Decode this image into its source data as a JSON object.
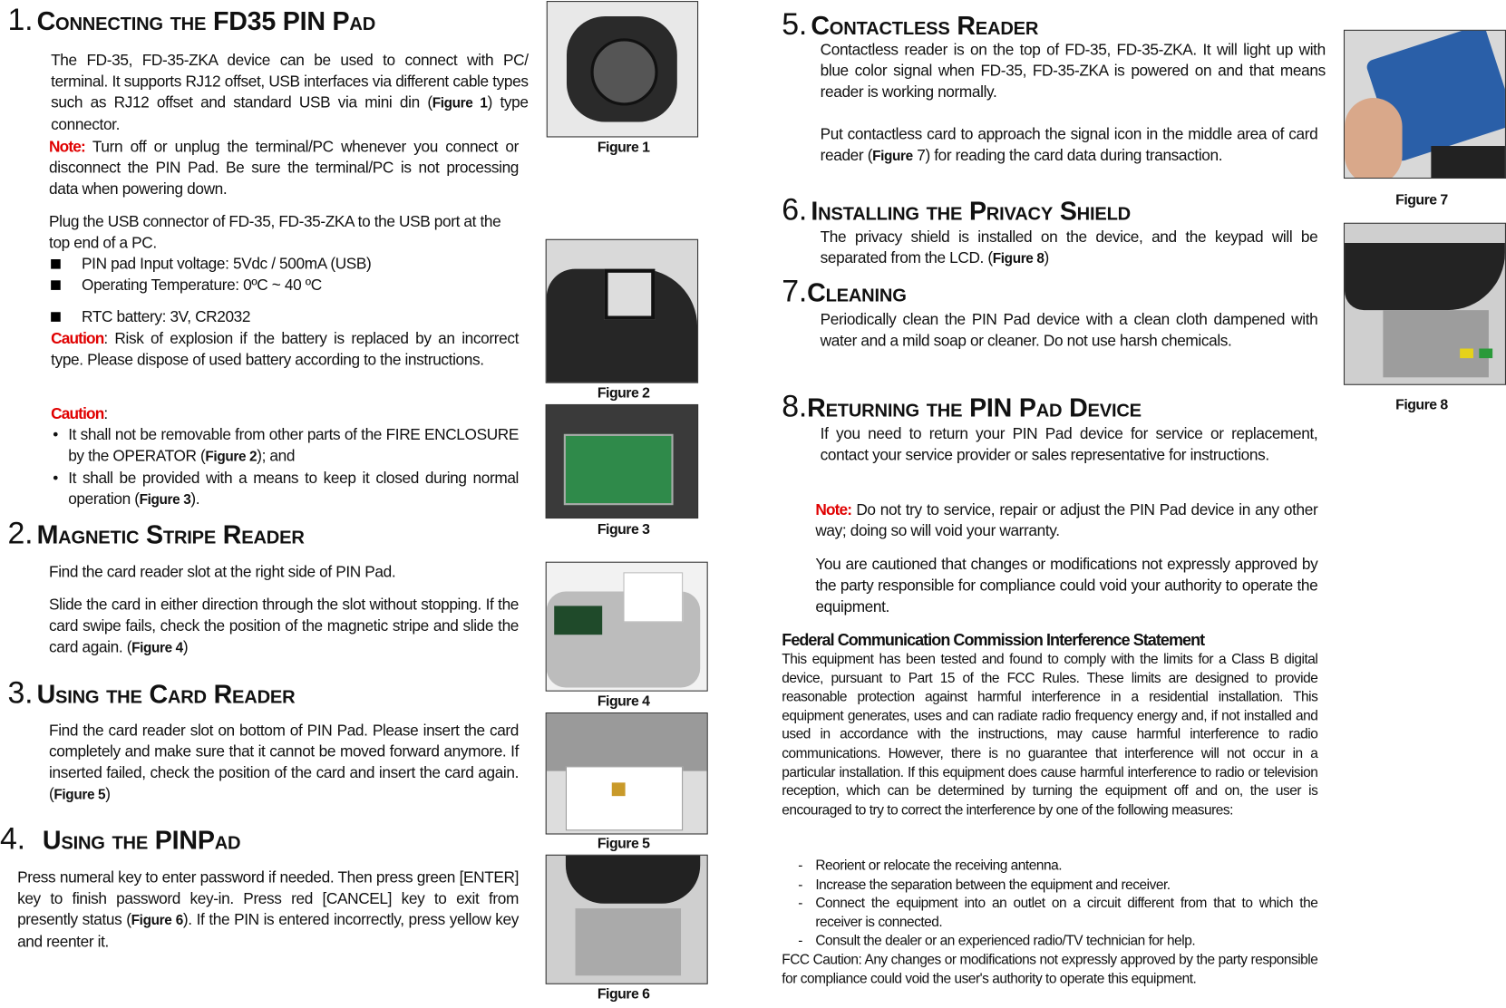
{
  "s1": {
    "num": "1.",
    "title": "Connecting the FD35 PIN Pad",
    "p1": "The FD-35, FD-35-ZKA device can be used to connect with PC/ terminal. It supports RJ12 offset, USB interfaces via different cable types such as RJ12 offset and standard USB via mini din (",
    "p1_ref": "Figure 1",
    "p1_end": ") type connector.",
    "note_label": "Note:",
    "note": " Turn off or unplug the terminal/PC whenever you connect or disconnect the PIN Pad.  Be sure the terminal/PC is not processing data when powering down.",
    "plug": "Plug the USB connector of FD-35, FD-35-ZKA to the USB port at the top end of a PC.",
    "bullets": [
      "PIN pad Input voltage: 5Vdc /  500mA (USB)",
      "Operating Temperature: 0ºC ~ 40 ºC",
      "RTC battery: 3V, CR2032"
    ],
    "caution_label": "Caution",
    "caution": ": Risk of explosion if the battery is replaced by an incorrect type. Please dispose of used battery according to the instructions.",
    "caution2_label": "Caution",
    "caution2_colon": ":",
    "c_items": [
      {
        "text": "It shall not be removable from other parts of the FIRE ENCLOSURE by the OPERATOR (",
        "ref": "Figure 2",
        "end": "); and"
      },
      {
        "text": "It shall be provided with a means to keep it closed during normal operation (",
        "ref": "Figure 3",
        "end": ")."
      }
    ]
  },
  "s2": {
    "num": "2.",
    "title": "Magnetic Stripe Reader",
    "p1": "Find the card reader slot at the right side of PIN Pad.",
    "p2": "Slide the card in either direction through the slot without stopping. If the card swipe fails, check the position of the magnetic stripe and slide the card again. (",
    "p2_ref": "Figure 4",
    "p2_end": ")"
  },
  "s3": {
    "num": "3.",
    "title": "Using the Card Reader",
    "p1": "Find the card reader slot on bottom of PIN Pad. Please insert the card completely and make sure that it cannot be moved forward anymore. If inserted failed, check the position of the card and insert the card again. (",
    "p1_ref": "Figure 5",
    "p1_end": ")"
  },
  "s4": {
    "num": "4.",
    "title": "Using the PINPad",
    "p1": "Press numeral key to enter password if needed. Then press green [ENTER] key to finish password key-in. Press red [CANCEL] key to exit from presently status (",
    "p1_ref": "Figure 6",
    "p1_end": "). If the PIN is entered incorrectly, press yellow key and reenter it."
  },
  "s5": {
    "num": "5.",
    "title": "Contactless Reader",
    "p1": "Contactless reader is on the top of FD-35, FD-35-ZKA. It will light up with blue color signal when FD-35, FD-35-ZKA is powered on and that means reader is working normally.",
    "p2": "Put contactless card to approach the signal icon in the middle area of card reader (",
    "p2_ref": "Figure",
    "p2_end": " 7) for reading the card data during transaction."
  },
  "s6": {
    "num": "6.",
    "title": "Installing the Privacy Shield",
    "p1": "The privacy shield is installed on the device, and the keypad will be separated from the LCD. (",
    "p1_ref": "Figure 8",
    "p1_end": ")"
  },
  "s7": {
    "num": "7.",
    "title": "Cleaning",
    "p1": "Periodically clean the PIN Pad device with a clean cloth dampened with water and a mild soap or cleaner.  Do not use harsh chemicals."
  },
  "s8": {
    "num": "8.",
    "title": "Returning the PIN Pad Device",
    "p1": "If you need to return your PIN Pad device for service or replacement, contact your service provider or sales representative for instructions.",
    "note_label": "Note:",
    "note": " Do not try to service, repair or adjust the PIN Pad device in any other way; doing so will void your warranty.",
    "p2": "You are cautioned that changes or modifications not expressly approved by the party responsible for compliance could void your authority to operate the equipment."
  },
  "fcc": {
    "title": "Federal Communication Commission Interference Statement",
    "body": "This equipment has been tested and found to comply with the limits for a Class B digital device, pursuant to Part 15 of the FCC Rules.  These limits are designed to provide reasonable protection against harmful interference in a residential installation.  This equipment generates, uses and can radiate radio frequency energy and, if not installed and used in accordance with the instructions, may cause harmful interference to radio communications.  However, there is no guarantee that interference will not occur in a particular installation.  If this equipment does cause harmful interference to radio or television reception, which can be determined by turning the equipment off and on, the user is encouraged to try to correct the interference by one of the following measures:",
    "measures": [
      "Reorient or relocate the receiving antenna.",
      "Increase the separation between the equipment and receiver.",
      "Connect the equipment into an outlet on a circuit different from that to which the receiver is connected.",
      "Consult the dealer or an experienced radio/TV technician for help."
    ],
    "caution": "FCC Caution: Any changes or modifications not expressly approved by the party responsible for compliance could void the user's authority to operate this equipment."
  },
  "figures": [
    "Figure 1",
    "Figure 2",
    "Figure 3",
    "Figure 4",
    "Figure 5",
    "Figure 6",
    "Figure 7",
    "Figure 8"
  ],
  "colors": {
    "warning_red": "#e00000",
    "text": "#111111"
  }
}
